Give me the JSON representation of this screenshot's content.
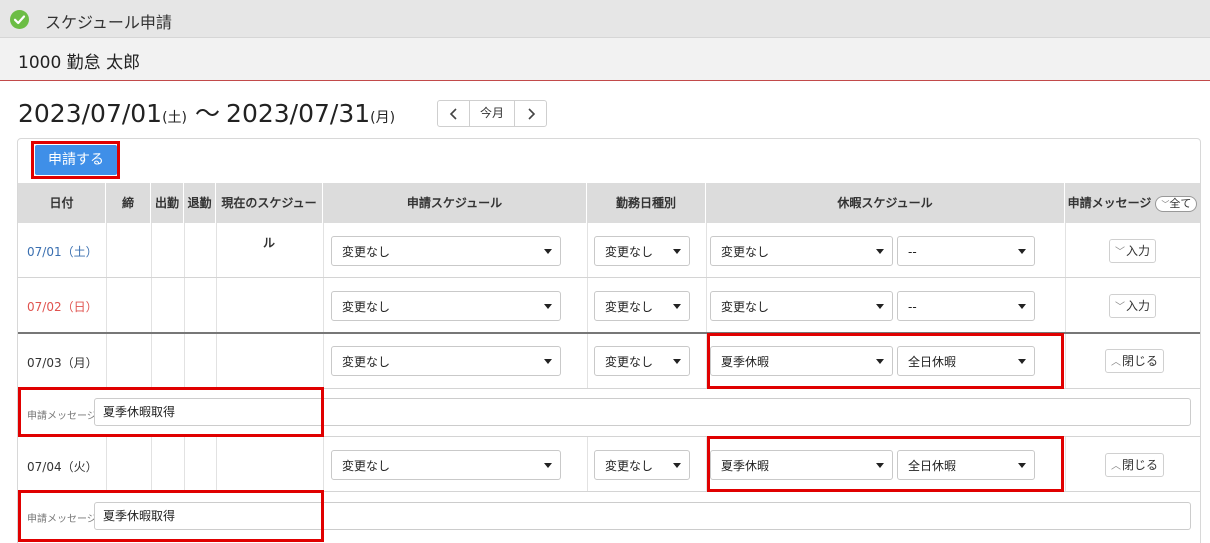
{
  "header": {
    "title": "スケジュール申請",
    "user": "1000 勤怠 太郎",
    "status_color": "#6cbd45"
  },
  "period": {
    "start_date": "2023/07/01",
    "start_dow": "(土)",
    "separator": "～",
    "end_date": "2023/07/31",
    "end_dow": "(月)"
  },
  "nav": {
    "prev": "<",
    "today": "今月",
    "next": ">"
  },
  "submit_label": "申請する",
  "columns": {
    "date": "日付",
    "close": "締",
    "in": "出勤",
    "out": "退勤",
    "current": "現在のスケジュール",
    "request": "申請スケジュール",
    "daytype": "勤務日種別",
    "leave": "休暇スケジュール",
    "message": "申請メッセージ",
    "all_toggle": "全て"
  },
  "rows": [
    {
      "date": "07/01（土）",
      "schedule": "変更なし",
      "daytype": "変更なし",
      "leave": "変更なし",
      "leave_unit": "--",
      "action": "入力"
    },
    {
      "date": "07/02（日）",
      "schedule": "変更なし",
      "daytype": "変更なし",
      "leave": "変更なし",
      "leave_unit": "--",
      "action": "入力"
    },
    {
      "date": "07/03（月）",
      "schedule": "変更なし",
      "daytype": "変更なし",
      "leave": "夏季休暇",
      "leave_unit": "全日休暇",
      "action": "閉じる"
    },
    {
      "date": "07/04（火）",
      "schedule": "変更なし",
      "daytype": "変更なし",
      "leave": "夏季休暇",
      "leave_unit": "全日休暇",
      "action": "閉じる"
    }
  ],
  "messages": [
    {
      "label": "申請メッセージ:",
      "value": "夏季休暇取得"
    },
    {
      "label": "申請メッセージ:",
      "value": "夏季休暇取得"
    }
  ],
  "colors": {
    "primary_button": "#3f8fe8",
    "highlight": "#e00000",
    "saturday": "#3a6fb0",
    "sunday": "#e0534f"
  }
}
